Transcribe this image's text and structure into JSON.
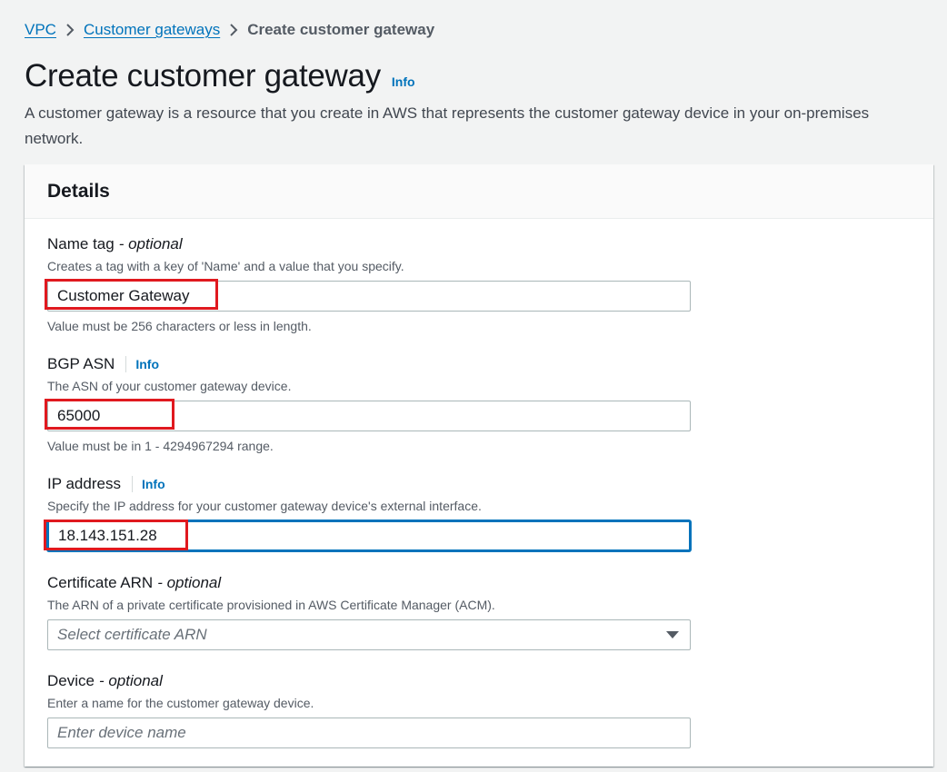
{
  "breadcrumb": {
    "items": [
      "VPC",
      "Customer gateways"
    ],
    "current": "Create customer gateway"
  },
  "header": {
    "title": "Create customer gateway",
    "info": "Info",
    "description": "A customer gateway is a resource that you create in AWS that represents the customer gateway device in your on-premises network."
  },
  "panel": {
    "title": "Details"
  },
  "fields": {
    "name_tag": {
      "label": "Name tag",
      "optional": "- optional",
      "description": "Creates a tag with a key of 'Name' and a value that you specify.",
      "value": "Customer Gateway",
      "constraint": "Value must be 256 characters or less in length."
    },
    "bgp_asn": {
      "label": "BGP ASN",
      "info": "Info",
      "description": "The ASN of your customer gateway device.",
      "value": "65000",
      "constraint": "Value must be in 1 - 4294967294 range."
    },
    "ip_address": {
      "label": "IP address",
      "info": "Info",
      "description": "Specify the IP address for your customer gateway device's external interface.",
      "value": "18.143.151.28"
    },
    "certificate_arn": {
      "label": "Certificate ARN",
      "optional": "- optional",
      "description": "The ARN of a private certificate provisioned in AWS Certificate Manager (ACM).",
      "placeholder": "Select certificate ARN"
    },
    "device": {
      "label": "Device",
      "optional": "- optional",
      "description": "Enter a name for the customer gateway device.",
      "placeholder": "Enter device name"
    }
  },
  "colors": {
    "link": "#0073bb",
    "highlight": "#e0191f",
    "focus": "#0073bb"
  }
}
